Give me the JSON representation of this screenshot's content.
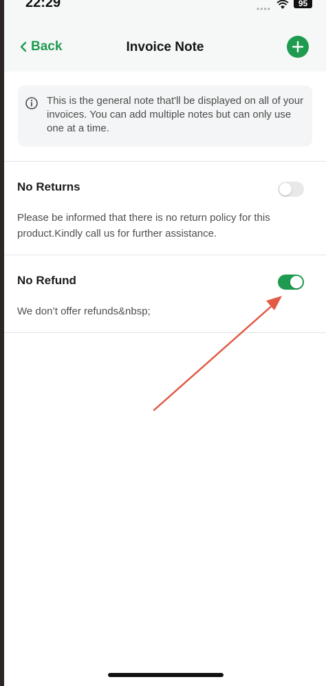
{
  "status_bar": {
    "time": "22:29",
    "battery": "95",
    "signal_icon": "signal-dots-icon",
    "wifi_icon": "wifi-icon"
  },
  "header": {
    "back_label": "Back",
    "title": "Invoice Note",
    "add_icon": "plus-icon"
  },
  "info": {
    "icon": "info-circle-icon",
    "text": "This is the general note that'll be displayed on all of your invoices. You can add multiple notes but can only use one at a time."
  },
  "notes": [
    {
      "title": "No Returns",
      "body": "Please be informed that there is no return policy for this product.Kindly call us for further assistance.",
      "enabled": false
    },
    {
      "title": "No Refund",
      "body": "We don’t offer refunds&nbsp;",
      "enabled": true
    }
  ],
  "colors": {
    "accent": "#1e9b4f",
    "annotation_arrow": "#e05a45"
  }
}
